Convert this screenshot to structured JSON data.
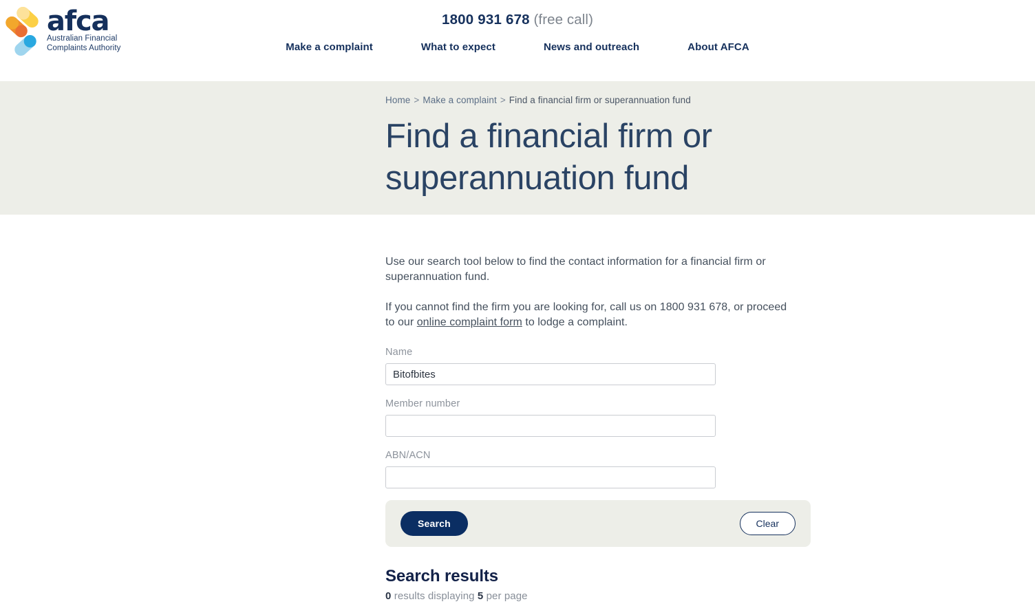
{
  "header": {
    "logo": {
      "wordmark": "afca",
      "subtitle_line1": "Australian Financial",
      "subtitle_line2": "Complaints Authority",
      "colors": {
        "navy": "#15305c",
        "yellow": "#fcd046",
        "yellow_light": "#fde59a",
        "orange": "#f0a32a",
        "orange_dark": "#e8722a",
        "blue": "#29a8e0",
        "blue_light": "#9fd5ee"
      }
    },
    "phone_number": "1800 931 678",
    "phone_note": "(free call)",
    "nav_items": [
      {
        "label": "Make a complaint"
      },
      {
        "label": "What to expect"
      },
      {
        "label": "News and outreach"
      },
      {
        "label": "About AFCA"
      }
    ]
  },
  "hero": {
    "breadcrumb": {
      "items": [
        {
          "label": "Home",
          "is_link": true
        },
        {
          "label": "Make a complaint",
          "is_link": true
        },
        {
          "label": "Find a financial firm or superannuation fund",
          "is_link": false
        }
      ],
      "separator": ">"
    },
    "page_title": "Find a financial firm or superannuation fund",
    "background_color": "#edeee8"
  },
  "main": {
    "intro_paragraph_1": "Use our search tool below to find the contact information for a financial firm or superannuation fund.",
    "intro_paragraph_2_before": "If you cannot find the firm you are looking for, call us on 1800 931 678, or proceed to our ",
    "intro_paragraph_2_link": "online complaint form",
    "intro_paragraph_2_after": " to lodge a complaint.",
    "form": {
      "fields": [
        {
          "label": "Name",
          "value": "Bitofbites",
          "placeholder": ""
        },
        {
          "label": "Member number",
          "value": "",
          "placeholder": ""
        },
        {
          "label": "ABN/ACN",
          "value": "",
          "placeholder": ""
        }
      ],
      "search_button": "Search",
      "clear_button": "Clear"
    },
    "results": {
      "heading": "Search results",
      "count": "0",
      "count_suffix": " results displaying ",
      "per_page": "5",
      "per_page_suffix": " per page"
    }
  }
}
